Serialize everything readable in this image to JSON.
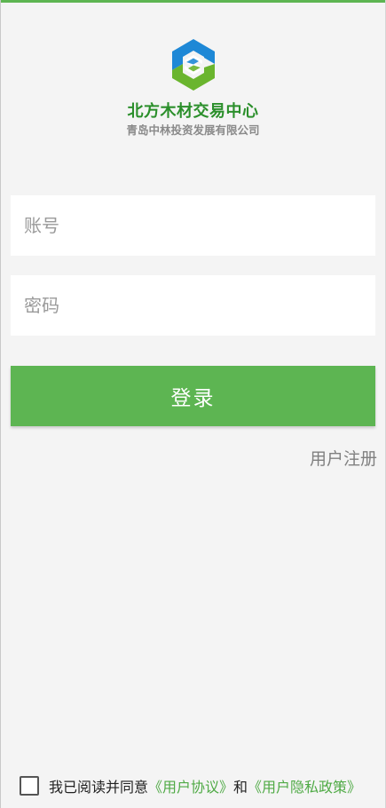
{
  "brand": {
    "title": "北方木材交易中心",
    "subtitle": "青岛中林投资发展有限公司",
    "logo_icon": "hexagon-s-logo-icon",
    "colors": {
      "accent": "#5db552",
      "title": "#2b8f2b",
      "logo_blue": "#1e88d6",
      "logo_green": "#6ab52e"
    }
  },
  "form": {
    "account_placeholder": "账号",
    "account_value": "",
    "password_placeholder": "密码",
    "password_value": "",
    "login_label": "登录"
  },
  "register": {
    "label": "用户注册"
  },
  "agreement": {
    "checked": false,
    "prefix": "我已阅读并同意",
    "user_agreement": "《用户协议》",
    "conjunction": "和",
    "privacy_policy": "《用户隐私政策》"
  }
}
